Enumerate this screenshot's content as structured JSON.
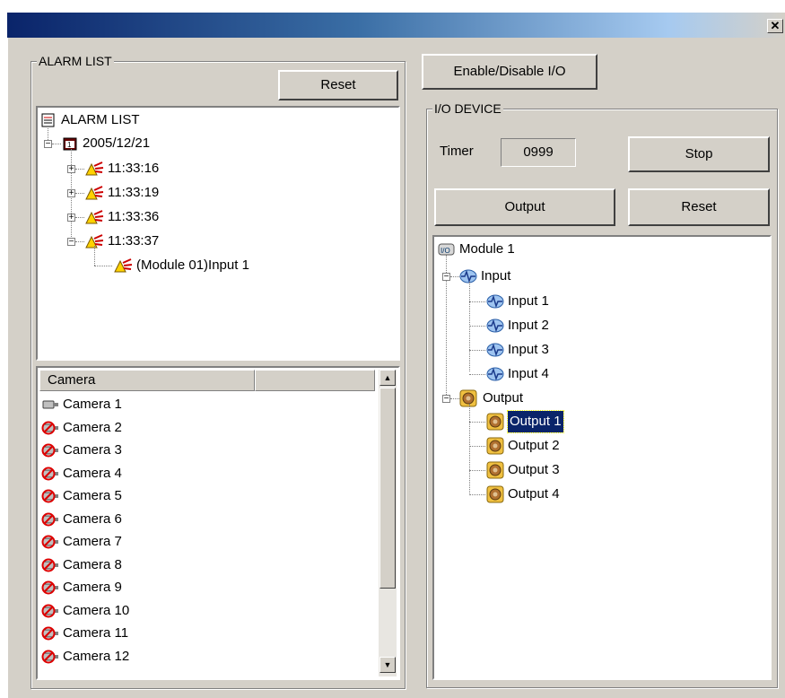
{
  "window": {
    "close_glyph": "✕"
  },
  "alarm_group": {
    "title": "ALARM LIST",
    "reset_label": "Reset"
  },
  "alarm_tree": {
    "root": "ALARM LIST",
    "date": "2005/12/21",
    "times": [
      "11:33:16",
      "11:33:19",
      "11:33:36",
      "11:33:37"
    ],
    "child": "(Module 01)Input 1"
  },
  "camera_list": {
    "header": "Camera",
    "items": [
      "Camera 1",
      "Camera 2",
      "Camera 3",
      "Camera 4",
      "Camera 5",
      "Camera 6",
      "Camera 7",
      "Camera 8",
      "Camera 9",
      "Camera 10",
      "Camera 11",
      "Camera 12"
    ]
  },
  "io": {
    "enable_label": "Enable/Disable I/O",
    "group_title": "I/O DEVICE",
    "timer_label": "Timer",
    "timer_value": "0999",
    "stop_label": "Stop",
    "output_label": "Output",
    "reset_label": "Reset",
    "tree": {
      "module": "Module 1",
      "input_group": "Input",
      "inputs": [
        "Input 1",
        "Input 2",
        "Input 3",
        "Input 4"
      ],
      "output_group": "Output",
      "outputs": [
        "Output 1",
        "Output 2",
        "Output 3",
        "Output 4"
      ],
      "selected": "Output 1"
    }
  },
  "colors": {
    "titlebar_start": "#0a246a",
    "selection": "#0a246a",
    "face": "#d4d0c8"
  }
}
